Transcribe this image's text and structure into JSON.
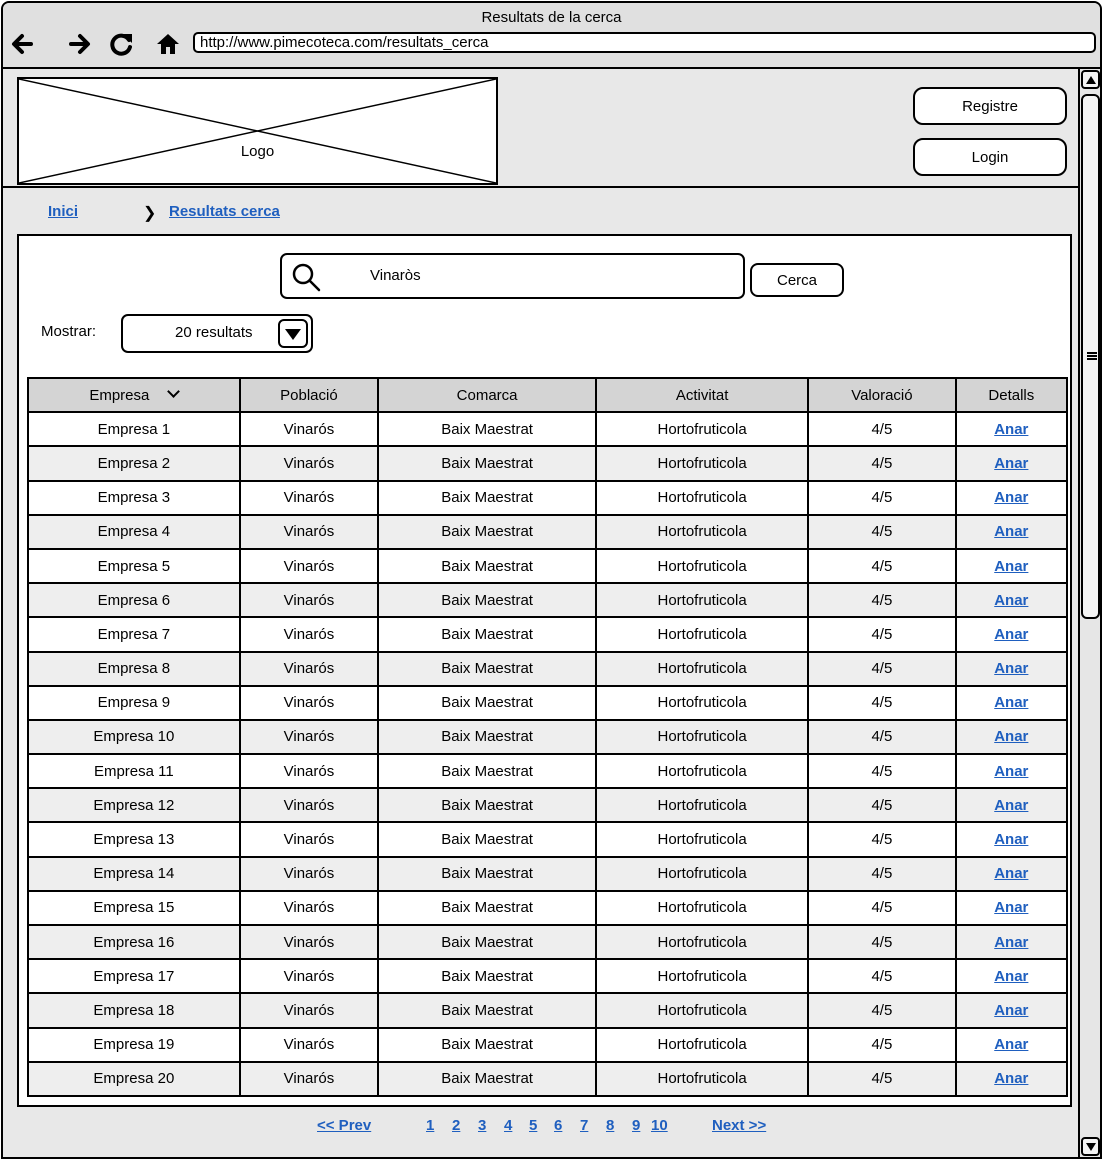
{
  "window": {
    "title": "Resultats de la cerca"
  },
  "browser": {
    "url": "http://www.pimecoteca.com/resultats_cerca",
    "icons": [
      "back-arrow-icon",
      "forward-arrow-icon",
      "reload-icon",
      "home-icon"
    ]
  },
  "header": {
    "logo_label": "Logo",
    "register_label": "Registre",
    "login_label": "Login"
  },
  "breadcrumb": {
    "home": "Inici",
    "current": "Resultats cerca"
  },
  "search": {
    "value": "Vinaròs",
    "button_label": "Cerca"
  },
  "show": {
    "label": "Mostrar:",
    "selected": "20 resultats"
  },
  "table": {
    "columns": [
      "Empresa",
      "Població",
      "Comarca",
      "Activitat",
      "Valoració",
      "Detalls"
    ],
    "rows": [
      [
        "Empresa 1",
        "Vinarós",
        "Baix Maestrat",
        "Hortofruticola",
        "4/5",
        "Anar"
      ],
      [
        "Empresa 2",
        "Vinarós",
        "Baix Maestrat",
        "Hortofruticola",
        "4/5",
        "Anar"
      ],
      [
        "Empresa 3",
        "Vinarós",
        "Baix Maestrat",
        "Hortofruticola",
        "4/5",
        "Anar"
      ],
      [
        "Empresa 4",
        "Vinarós",
        "Baix Maestrat",
        "Hortofruticola",
        "4/5",
        "Anar"
      ],
      [
        "Empresa 5",
        "Vinarós",
        "Baix Maestrat",
        "Hortofruticola",
        "4/5",
        "Anar"
      ],
      [
        "Empresa 6",
        "Vinarós",
        "Baix Maestrat",
        "Hortofruticola",
        "4/5",
        "Anar"
      ],
      [
        "Empresa 7",
        "Vinarós",
        "Baix Maestrat",
        "Hortofruticola",
        "4/5",
        "Anar"
      ],
      [
        "Empresa 8",
        "Vinarós",
        "Baix Maestrat",
        "Hortofruticola",
        "4/5",
        "Anar"
      ],
      [
        "Empresa 9",
        "Vinarós",
        "Baix Maestrat",
        "Hortofruticola",
        "4/5",
        "Anar"
      ],
      [
        "Empresa 10",
        "Vinarós",
        "Baix Maestrat",
        "Hortofruticola",
        "4/5",
        "Anar"
      ],
      [
        "Empresa 11",
        "Vinarós",
        "Baix Maestrat",
        "Hortofruticola",
        "4/5",
        "Anar"
      ],
      [
        "Empresa 12",
        "Vinarós",
        "Baix Maestrat",
        "Hortofruticola",
        "4/5",
        "Anar"
      ],
      [
        "Empresa 13",
        "Vinarós",
        "Baix Maestrat",
        "Hortofruticola",
        "4/5",
        "Anar"
      ],
      [
        "Empresa 14",
        "Vinarós",
        "Baix Maestrat",
        "Hortofruticola",
        "4/5",
        "Anar"
      ],
      [
        "Empresa 15",
        "Vinarós",
        "Baix Maestrat",
        "Hortofruticola",
        "4/5",
        "Anar"
      ],
      [
        "Empresa 16",
        "Vinarós",
        "Baix Maestrat",
        "Hortofruticola",
        "4/5",
        "Anar"
      ],
      [
        "Empresa 17",
        "Vinarós",
        "Baix Maestrat",
        "Hortofruticola",
        "4/5",
        "Anar"
      ],
      [
        "Empresa 18",
        "Vinarós",
        "Baix Maestrat",
        "Hortofruticola",
        "4/5",
        "Anar"
      ],
      [
        "Empresa 19",
        "Vinarós",
        "Baix Maestrat",
        "Hortofruticola",
        "4/5",
        "Anar"
      ],
      [
        "Empresa 20",
        "Vinarós",
        "Baix Maestrat",
        "Hortofruticola",
        "4/5",
        "Anar"
      ]
    ]
  },
  "pagination": {
    "prev": "<< Prev",
    "pages": [
      "1",
      "2",
      "3",
      "4",
      "5",
      "6",
      "7",
      "8",
      "9",
      "10"
    ],
    "next": "Next >>"
  },
  "colors": {
    "link": "#1f5fbf",
    "header_row": "#d4d4d4",
    "alt_row": "#eeeeee"
  }
}
